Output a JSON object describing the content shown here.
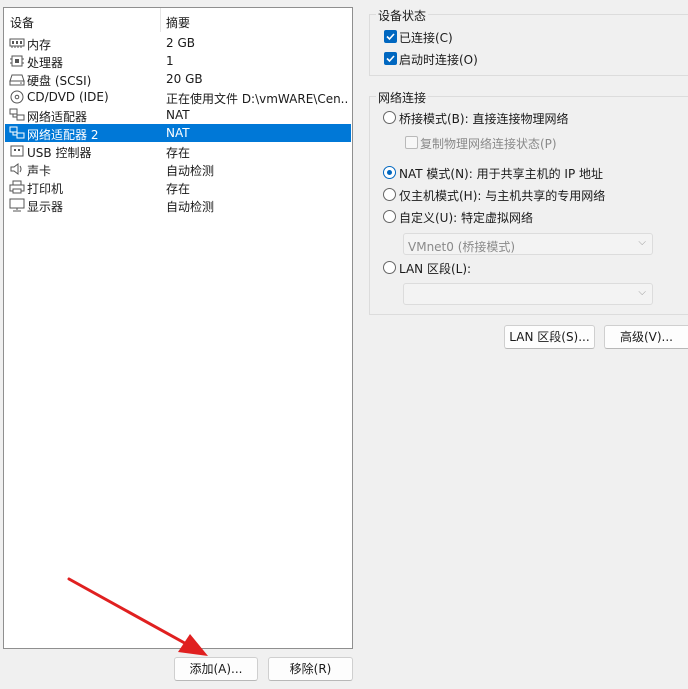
{
  "device_list": {
    "headers": {
      "device": "设备",
      "summary": "摘要"
    },
    "rows": [
      {
        "icon": "memory-icon",
        "name": "内存",
        "summary": "2 GB"
      },
      {
        "icon": "processor-icon",
        "name": "处理器",
        "summary": "1"
      },
      {
        "icon": "harddisk-icon",
        "name": "硬盘 (SCSI)",
        "summary": "20 GB"
      },
      {
        "icon": "cd-dvd-icon",
        "name": "CD/DVD (IDE)",
        "summary": "正在使用文件 D:\\vmWARE\\Cen..."
      },
      {
        "icon": "network-adapter-icon",
        "name": "网络适配器",
        "summary": "NAT"
      },
      {
        "icon": "network-adapter-icon",
        "name": "网络适配器 2",
        "summary": "NAT"
      },
      {
        "icon": "usb-icon",
        "name": "USB 控制器",
        "summary": "存在"
      },
      {
        "icon": "sound-card-icon",
        "name": "声卡",
        "summary": "自动检测"
      },
      {
        "icon": "printer-icon",
        "name": "打印机",
        "summary": "存在"
      },
      {
        "icon": "display-icon",
        "name": "显示器",
        "summary": "自动检测"
      }
    ],
    "selected_index": 5
  },
  "buttons": {
    "add": "添加(A)...",
    "remove": "移除(R)",
    "lan_segment": "LAN 区段(S)...",
    "advanced": "高级(V)..."
  },
  "device_status": {
    "title": "设备状态",
    "connected": {
      "label": "已连接(C)",
      "checked": true
    },
    "connect_at_power_on": {
      "label": "启动时连接(O)",
      "checked": true
    }
  },
  "network_connection": {
    "title": "网络连接",
    "bridged": {
      "label": "桥接模式(B): 直接连接物理网络",
      "checked": false
    },
    "replicate": {
      "label": "复制物理网络连接状态(P)",
      "checked": false
    },
    "nat": {
      "label": "NAT 模式(N): 用于共享主机的 IP 地址",
      "checked": true
    },
    "host_only": {
      "label": "仅主机模式(H): 与主机共享的专用网络",
      "checked": false
    },
    "custom": {
      "label": "自定义(U): 特定虚拟网络",
      "checked": false
    },
    "custom_select": "VMnet0 (桥接模式)",
    "lan_segment": {
      "label": "LAN 区段(L):",
      "checked": false
    },
    "lan_select": ""
  },
  "colors": {
    "accent": "#0067c0",
    "selection": "#0078d7",
    "arrow": "#e02020"
  }
}
